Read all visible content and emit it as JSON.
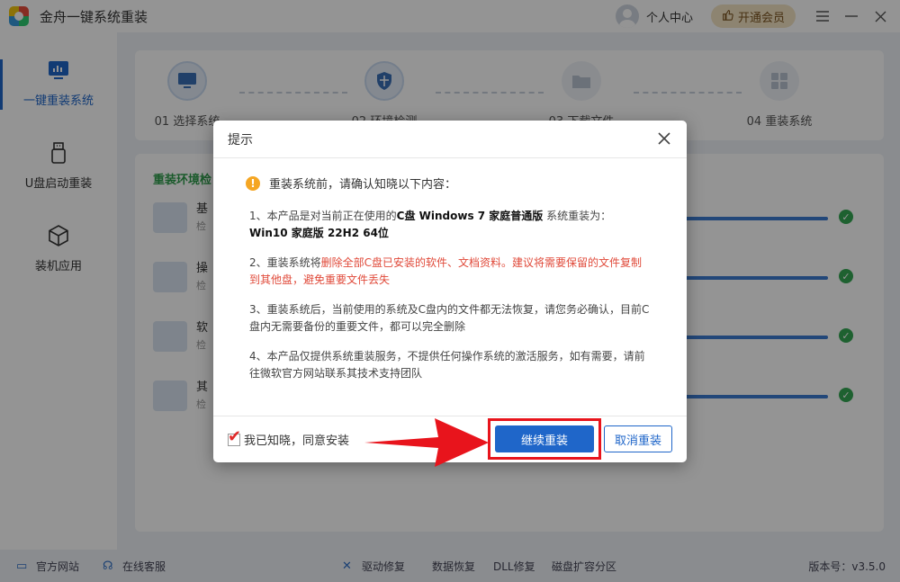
{
  "app": {
    "title": "金舟一键系统重装",
    "user_center": "个人中心",
    "vip_button": "开通会员"
  },
  "sidebar": {
    "items": [
      {
        "label": "一键重装系统",
        "active": true
      },
      {
        "label": "U盘启动重装",
        "active": false
      },
      {
        "label": "装机应用",
        "active": false
      }
    ]
  },
  "steps": [
    {
      "label": "01 选择系统"
    },
    {
      "label": "02 环境检测"
    },
    {
      "label": "03 下载文件"
    },
    {
      "label": "04 重装系统"
    }
  ],
  "env": {
    "title": "重装环境检",
    "rows": [
      {
        "name": "基",
        "sub": "检"
      },
      {
        "name": "操",
        "sub": "检"
      },
      {
        "name": "软",
        "sub": "检"
      },
      {
        "name": "其",
        "sub": "检"
      }
    ]
  },
  "dialog": {
    "title": "提示",
    "warning": "重装系统前，请确认知晓以下内容：",
    "p1_prefix": "1、本产品是对当前正在使用的",
    "p1_bold": "C盘 Windows 7 家庭普通版",
    "p1_suffix": " 系统重装为：",
    "p1_target": "Win10 家庭版 22H2 64位",
    "p2_prefix": "2、重装系统将",
    "p2_red": "删除全部C盘已安装的软件、文档资料。建议将需要保留的文件复制到其他盘，避免重要文件丢失",
    "p3": "3、重装系统后，当前使用的系统及C盘内的文件都无法恢复，请您务必确认，目前C盘内无需要备份的重要文件，都可以完全删除",
    "p4": "4、本产品仅提供系统重装服务，不提供任何操作系统的激活服务，如有需要，请前往微软官方网站联系其技术支持团队",
    "agree_label": "我已知晓，同意安装",
    "agree_checked": true,
    "continue_button": "继续重装",
    "cancel_button": "取消重装"
  },
  "footer": {
    "official_site": "官方网站",
    "online_service": "在线客服",
    "driver_repair": "驱动修复",
    "data_recovery": "数据恢复",
    "dll_repair": "DLL修复",
    "disk_partition": "磁盘扩容分区",
    "version": "版本号：v3.5.0"
  },
  "colors": {
    "accent": "#1f66c9",
    "warning_red": "#e04a3a",
    "success_green": "#34a853",
    "highlight_red": "#e8141c"
  }
}
